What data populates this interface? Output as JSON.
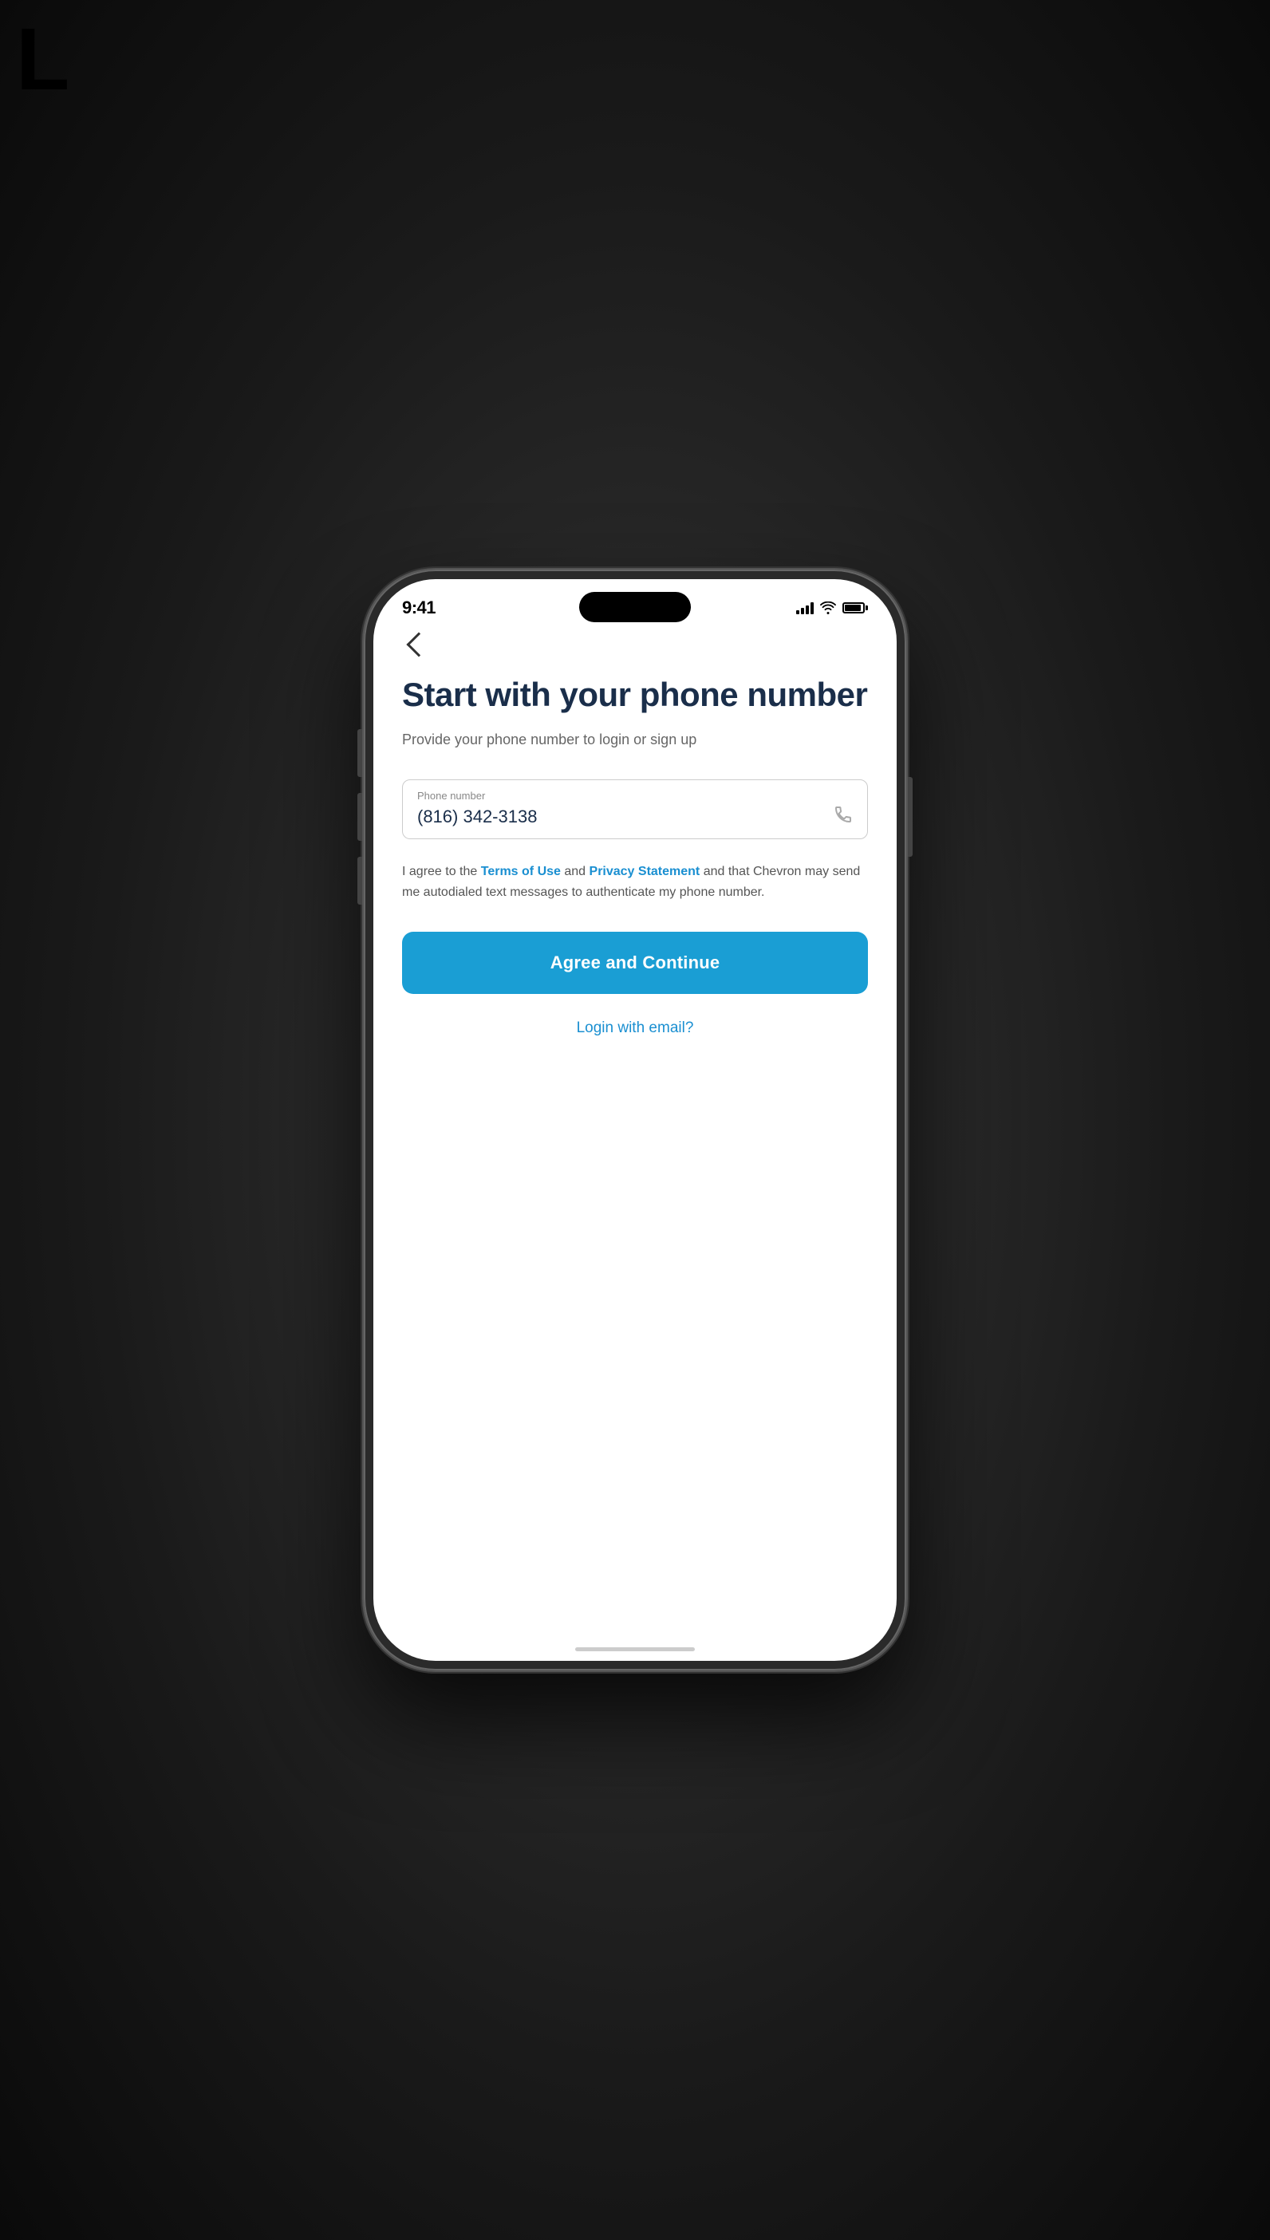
{
  "corner": {
    "letter": "L"
  },
  "status_bar": {
    "time": "9:41",
    "signal_label": "Signal",
    "wifi_label": "WiFi",
    "battery_label": "Battery"
  },
  "header": {
    "back_label": "Back"
  },
  "page": {
    "title": "Start with your phone number",
    "subtitle": "Provide your phone number to login or sign up"
  },
  "phone_input": {
    "label": "Phone number",
    "value": "(816) 342-3138",
    "placeholder": "Phone number"
  },
  "terms": {
    "prefix": "I agree to the ",
    "terms_link": "Terms of Use",
    "middle": " and ",
    "privacy_link": "Privacy Statement",
    "suffix": " and that Chevron may send me autodialed text messages to authenticate my phone number."
  },
  "actions": {
    "agree_button": "Agree and Continue",
    "email_login": "Login with email?"
  }
}
